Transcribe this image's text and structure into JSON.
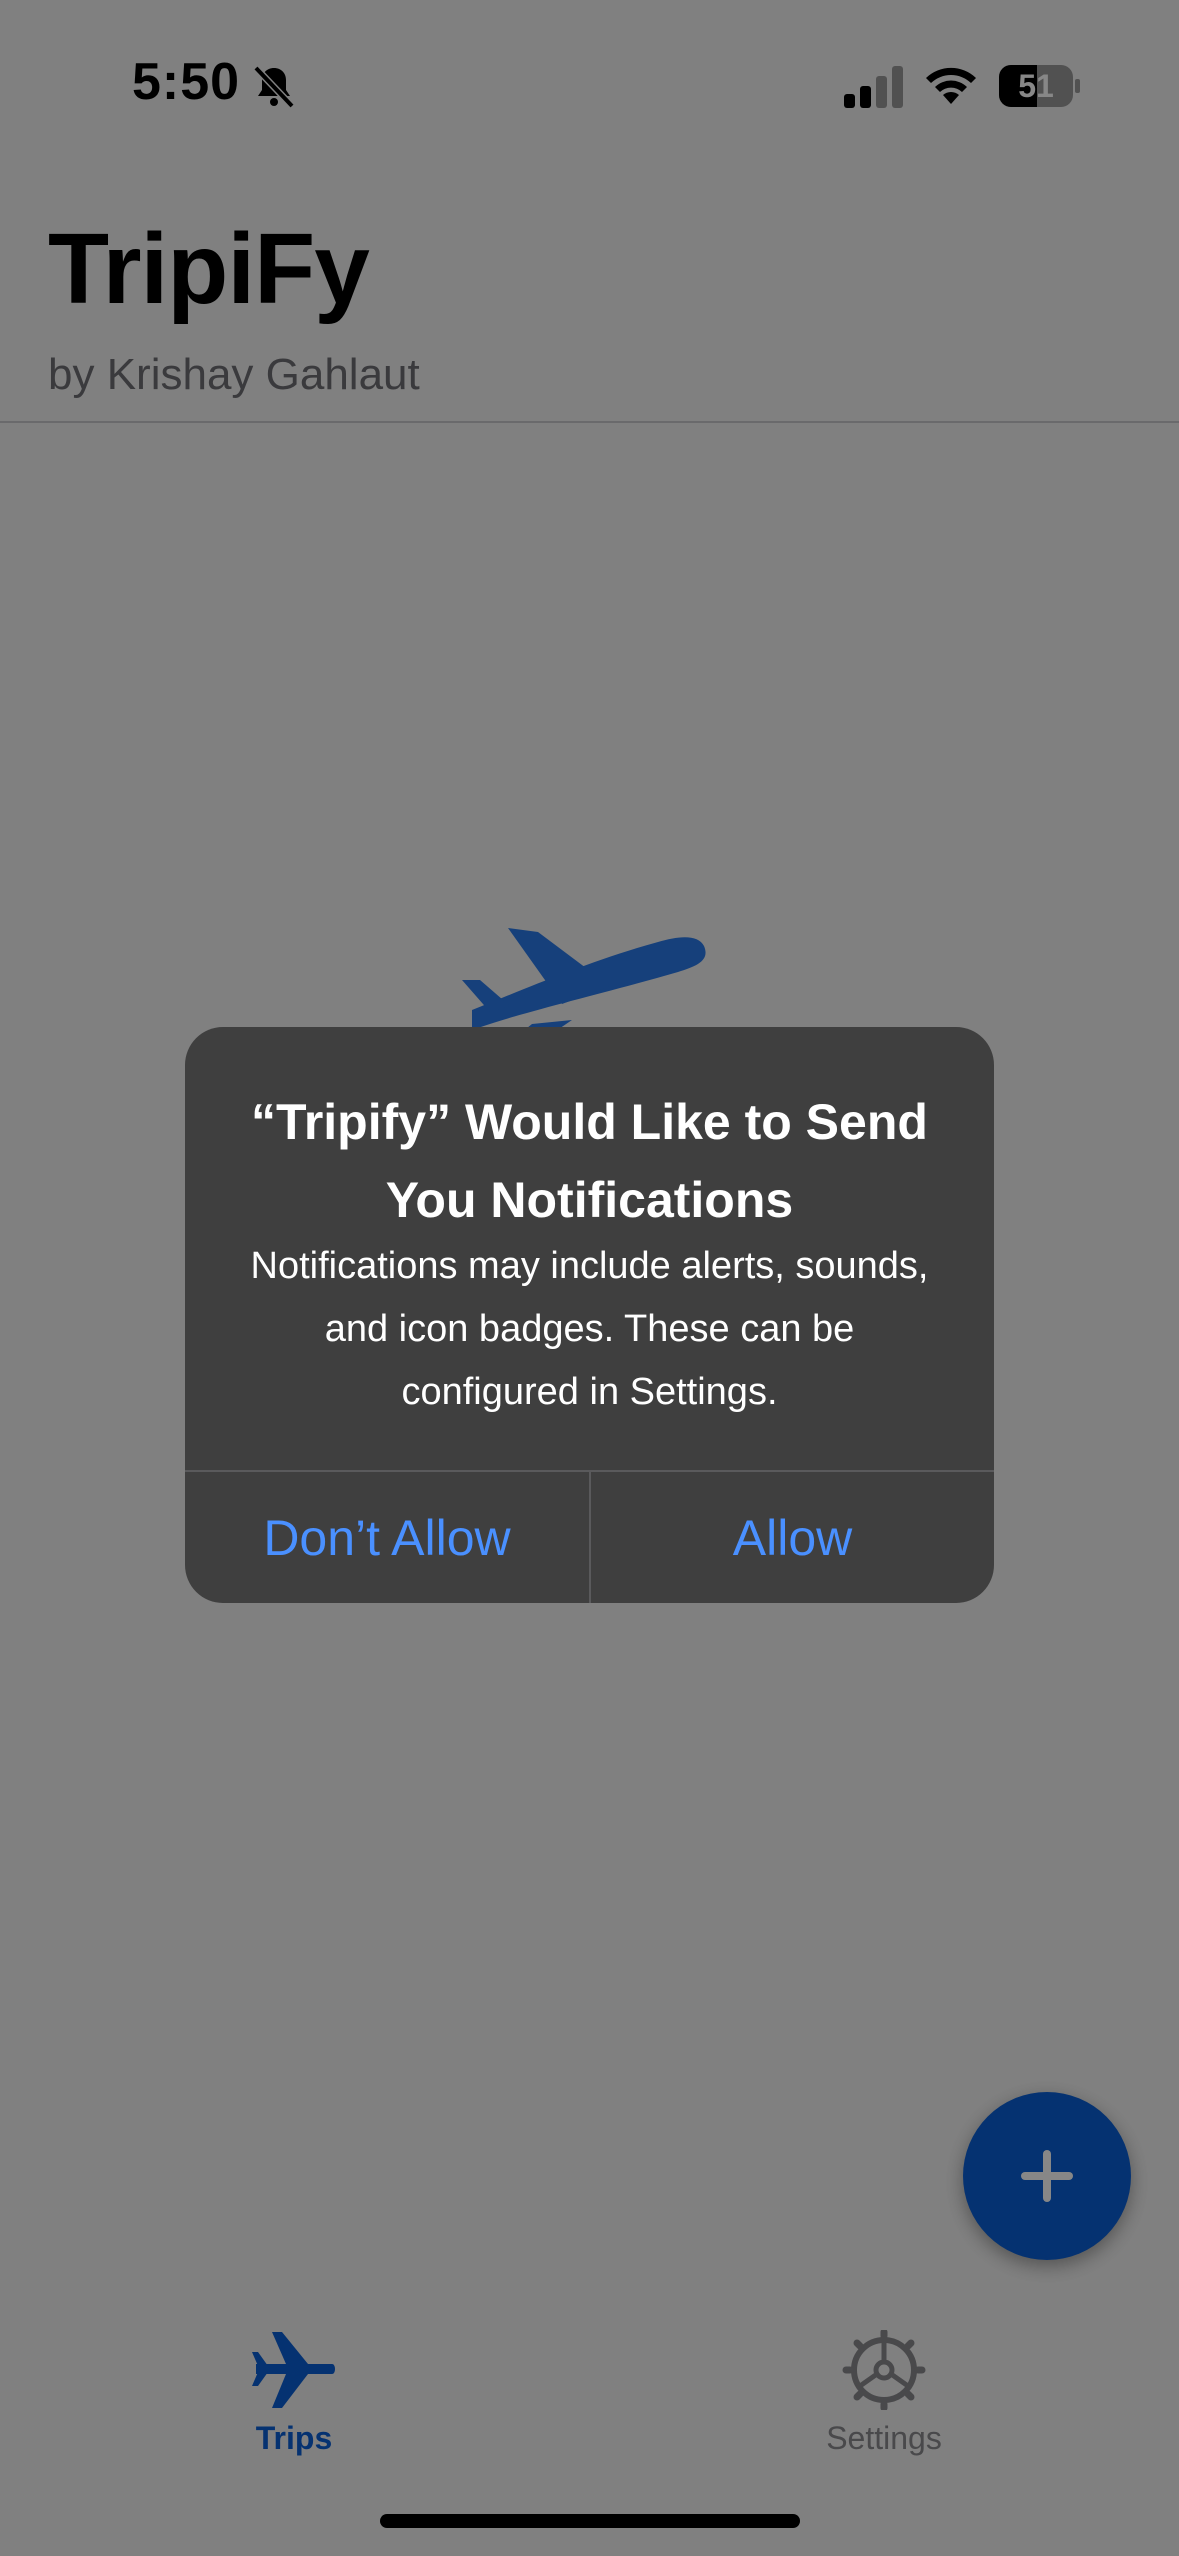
{
  "status_bar": {
    "time": "5:50",
    "battery": "51"
  },
  "header": {
    "title": "TripiFy",
    "subtitle": "by Krishay Gahlaut"
  },
  "tab_bar": {
    "trips_label": "Trips",
    "settings_label": "Settings"
  },
  "alert": {
    "title": "“Tripify” Would Like to Send You Notifications",
    "message": "Notifications may include alerts, sounds, and icon badges. These can be configured in Settings.",
    "deny_label": "Don’t Allow",
    "allow_label": "Allow"
  },
  "icons": {
    "hero": "airplane-icon",
    "fab": "plus-icon",
    "trips_tab": "airplane-icon",
    "settings_tab": "gear-icon",
    "status": [
      "bell-slash-icon",
      "cellular-signal-icon",
      "wifi-icon",
      "battery-icon"
    ]
  },
  "colors": {
    "accent": "#0a5fd6",
    "alert_button": "#4a90ff",
    "alert_bg": "#3f3f3f"
  }
}
